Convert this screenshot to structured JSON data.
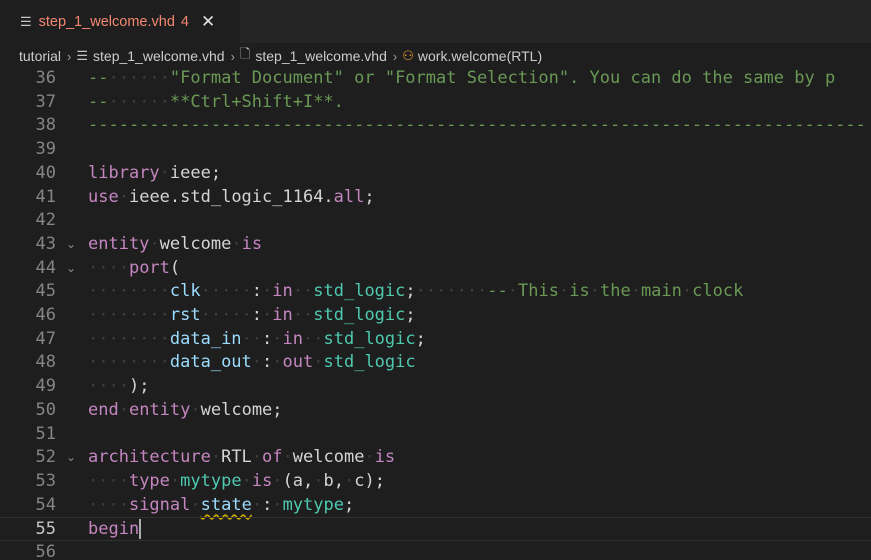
{
  "tab": {
    "file_icon": "file-lines-icon",
    "filename": "step_1_welcome.vhd",
    "problem_count": "4",
    "close_glyph": "✕"
  },
  "breadcrumb": {
    "items": [
      "tutorial",
      "step_1_welcome.vhd",
      "step_1_welcome.vhd",
      "work.welcome(RTL)"
    ]
  },
  "colors": {
    "keyword": "#c586c0",
    "type": "#4ec9b0",
    "comment": "#6a9955",
    "error_tab": "#f48771",
    "warning_squiggle": "#cca700"
  },
  "editor": {
    "current_line": "55",
    "lines": [
      {
        "no": "36",
        "fold": false,
        "tokens": [
          [
            "c",
            "--"
          ],
          [
            "ws",
            "······"
          ],
          [
            "c",
            "\"Format Document\" or \"Format Selection\". You can do the same by p"
          ]
        ]
      },
      {
        "no": "37",
        "fold": false,
        "tokens": [
          [
            "c",
            "--"
          ],
          [
            "ws",
            "······"
          ],
          [
            "c",
            "**Ctrl+Shift+I**."
          ]
        ]
      },
      {
        "no": "38",
        "fold": false,
        "tokens": [
          [
            "c",
            "----------------------------------------------------------------------------"
          ]
        ]
      },
      {
        "no": "39",
        "fold": false,
        "tokens": []
      },
      {
        "no": "40",
        "fold": false,
        "tokens": [
          [
            "k",
            "library"
          ],
          [
            "ws",
            "·"
          ],
          [
            "p",
            "ieee;"
          ]
        ]
      },
      {
        "no": "41",
        "fold": false,
        "tokens": [
          [
            "k",
            "use"
          ],
          [
            "ws",
            "·"
          ],
          [
            "p",
            "ieee.std_logic_1164."
          ],
          [
            "k",
            "all"
          ],
          [
            "p",
            ";"
          ]
        ]
      },
      {
        "no": "42",
        "fold": false,
        "tokens": []
      },
      {
        "no": "43",
        "fold": true,
        "tokens": [
          [
            "k",
            "entity"
          ],
          [
            "ws",
            "·"
          ],
          [
            "p",
            "welcome"
          ],
          [
            "ws",
            "·"
          ],
          [
            "k",
            "is"
          ]
        ]
      },
      {
        "no": "44",
        "fold": true,
        "tokens": [
          [
            "ws",
            "····"
          ],
          [
            "k",
            "port"
          ],
          [
            "p",
            "("
          ]
        ]
      },
      {
        "no": "45",
        "fold": false,
        "tokens": [
          [
            "ws",
            "········"
          ],
          [
            "v",
            "clk"
          ],
          [
            "ws",
            "·····"
          ],
          [
            "p",
            ":"
          ],
          [
            "ws",
            "·"
          ],
          [
            "k",
            "in"
          ],
          [
            "ws",
            "··"
          ],
          [
            "t",
            "std_logic"
          ],
          [
            "p",
            ";"
          ],
          [
            "ws",
            "·······"
          ],
          [
            "c",
            "--"
          ],
          [
            "ws",
            "·"
          ],
          [
            "c",
            "This"
          ],
          [
            "ws",
            "·"
          ],
          [
            "c",
            "is"
          ],
          [
            "ws",
            "·"
          ],
          [
            "c",
            "the"
          ],
          [
            "ws",
            "·"
          ],
          [
            "c",
            "main"
          ],
          [
            "ws",
            "·"
          ],
          [
            "c",
            "clock"
          ]
        ]
      },
      {
        "no": "46",
        "fold": false,
        "tokens": [
          [
            "ws",
            "········"
          ],
          [
            "v",
            "rst"
          ],
          [
            "ws",
            "·····"
          ],
          [
            "p",
            ":"
          ],
          [
            "ws",
            "·"
          ],
          [
            "k",
            "in"
          ],
          [
            "ws",
            "··"
          ],
          [
            "t",
            "std_logic"
          ],
          [
            "p",
            ";"
          ]
        ]
      },
      {
        "no": "47",
        "fold": false,
        "tokens": [
          [
            "ws",
            "········"
          ],
          [
            "v",
            "data_in"
          ],
          [
            "ws",
            "··"
          ],
          [
            "p",
            ":"
          ],
          [
            "ws",
            "·"
          ],
          [
            "k",
            "in"
          ],
          [
            "ws",
            "··"
          ],
          [
            "t",
            "std_logic"
          ],
          [
            "p",
            ";"
          ]
        ]
      },
      {
        "no": "48",
        "fold": false,
        "tokens": [
          [
            "ws",
            "········"
          ],
          [
            "v",
            "data_out"
          ],
          [
            "ws",
            "·"
          ],
          [
            "p",
            ":"
          ],
          [
            "ws",
            "·"
          ],
          [
            "k",
            "out"
          ],
          [
            "ws",
            "·"
          ],
          [
            "t",
            "std_logic"
          ]
        ]
      },
      {
        "no": "49",
        "fold": false,
        "tokens": [
          [
            "ws",
            "····"
          ],
          [
            "p",
            ");"
          ]
        ]
      },
      {
        "no": "50",
        "fold": false,
        "tokens": [
          [
            "k",
            "end"
          ],
          [
            "ws",
            "·"
          ],
          [
            "k",
            "entity"
          ],
          [
            "ws",
            "·"
          ],
          [
            "p",
            "welcome;"
          ]
        ]
      },
      {
        "no": "51",
        "fold": false,
        "tokens": []
      },
      {
        "no": "52",
        "fold": true,
        "tokens": [
          [
            "k",
            "architecture"
          ],
          [
            "ws",
            "·"
          ],
          [
            "p",
            "RTL"
          ],
          [
            "ws",
            "·"
          ],
          [
            "k",
            "of"
          ],
          [
            "ws",
            "·"
          ],
          [
            "p",
            "welcome"
          ],
          [
            "ws",
            "·"
          ],
          [
            "k",
            "is"
          ]
        ]
      },
      {
        "no": "53",
        "fold": false,
        "tokens": [
          [
            "ws",
            "····"
          ],
          [
            "k",
            "type"
          ],
          [
            "ws",
            "·"
          ],
          [
            "t",
            "mytype"
          ],
          [
            "ws",
            "·"
          ],
          [
            "k",
            "is"
          ],
          [
            "ws",
            "·"
          ],
          [
            "p",
            "(a,"
          ],
          [
            "ws",
            "·"
          ],
          [
            "p",
            "b,"
          ],
          [
            "ws",
            "·"
          ],
          [
            "p",
            "c);"
          ]
        ]
      },
      {
        "no": "54",
        "fold": false,
        "tokens": [
          [
            "ws",
            "····"
          ],
          [
            "k",
            "signal"
          ],
          [
            "ws",
            "·"
          ],
          [
            "sq",
            "state"
          ],
          [
            "ws",
            "·"
          ],
          [
            "p",
            ":"
          ],
          [
            "ws",
            "·"
          ],
          [
            "t",
            "mytype"
          ],
          [
            "p",
            ";"
          ]
        ]
      },
      {
        "no": "55",
        "fold": false,
        "tokens": [
          [
            "k",
            "begin"
          ],
          [
            "cur",
            ""
          ]
        ]
      },
      {
        "no": "56",
        "fold": false,
        "tokens": []
      }
    ]
  }
}
